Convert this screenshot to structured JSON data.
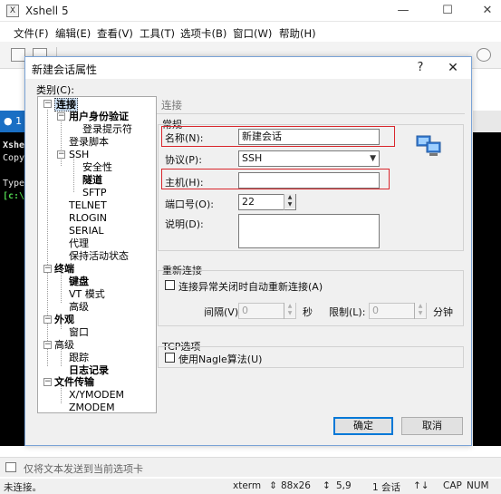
{
  "main_window": {
    "title": "Xshell 5",
    "minimize": "—",
    "maximize": "☐",
    "close": "✕"
  },
  "menu": [
    "文件(F)",
    "编辑(E)",
    "查看(V)",
    "工具(T)",
    "选项卡(B)",
    "窗口(W)",
    "帮助(H)"
  ],
  "tab": {
    "label": "1"
  },
  "terminal_lines": [
    "Xshel",
    "Copyr",
    "",
    "Type",
    "[c:\\~"
  ],
  "send_bar": {
    "placeholder": "仅将文本发送到当前选项卡"
  },
  "status_bar": {
    "connection": "未连接。",
    "terminal": "xterm",
    "size": "88x26",
    "cursor": "5,9",
    "sessions": "1 会话",
    "caps": "CAP",
    "num": "NUM"
  },
  "dialog": {
    "title": "新建会话属性",
    "help": "?",
    "close": "✕",
    "category_label": "类别(C):",
    "tree": [
      {
        "label": "连接",
        "bold": true,
        "selected": true
      },
      {
        "label": "用户身份验证",
        "bold": true
      },
      {
        "label": "登录提示符",
        "bold": false
      },
      {
        "label": "登录脚本",
        "bold": false
      },
      {
        "label": "SSH",
        "bold": false
      },
      {
        "label": "安全性",
        "bold": false
      },
      {
        "label": "隧道",
        "bold": true
      },
      {
        "label": "SFTP",
        "bold": false
      },
      {
        "label": "TELNET",
        "bold": false
      },
      {
        "label": "RLOGIN",
        "bold": false
      },
      {
        "label": "SERIAL",
        "bold": false
      },
      {
        "label": "代理",
        "bold": false
      },
      {
        "label": "保持活动状态",
        "bold": false
      },
      {
        "label": "终端",
        "bold": true
      },
      {
        "label": "键盘",
        "bold": true
      },
      {
        "label": "VT 模式",
        "bold": false
      },
      {
        "label": "高级",
        "bold": false
      },
      {
        "label": "外观",
        "bold": true
      },
      {
        "label": "窗口",
        "bold": false
      },
      {
        "label": "高级",
        "bold": false
      },
      {
        "label": "跟踪",
        "bold": false
      },
      {
        "label": "日志记录",
        "bold": true
      },
      {
        "label": "文件传输",
        "bold": true
      },
      {
        "label": "X/YMODEM",
        "bold": false
      },
      {
        "label": "ZMODEM",
        "bold": false
      }
    ],
    "section_title": "连接",
    "general": {
      "title": "常规",
      "name_label": "名称(N):",
      "name_value": "新建会话",
      "protocol_label": "协议(P):",
      "protocol_value": "SSH",
      "host_label": "主机(H):",
      "host_value": "",
      "port_label": "端口号(O):",
      "port_value": "22",
      "desc_label": "说明(D):"
    },
    "reconnect": {
      "title": "重新连接",
      "checkbox_label": "连接异常关闭时自动重新连接(A)",
      "interval_label": "间隔(V):",
      "interval_value": "0",
      "interval_unit": "秒",
      "limit_label": "限制(L):",
      "limit_value": "0",
      "limit_unit": "分钟"
    },
    "tcp": {
      "title": "TCP选项",
      "nagle_label": "使用Nagle算法(U)"
    },
    "ok": "确定",
    "cancel": "取消"
  },
  "colors": {
    "highlight": "#d9262c",
    "tab_active": "#1a6fc4",
    "selection": "#cfe3f8"
  }
}
